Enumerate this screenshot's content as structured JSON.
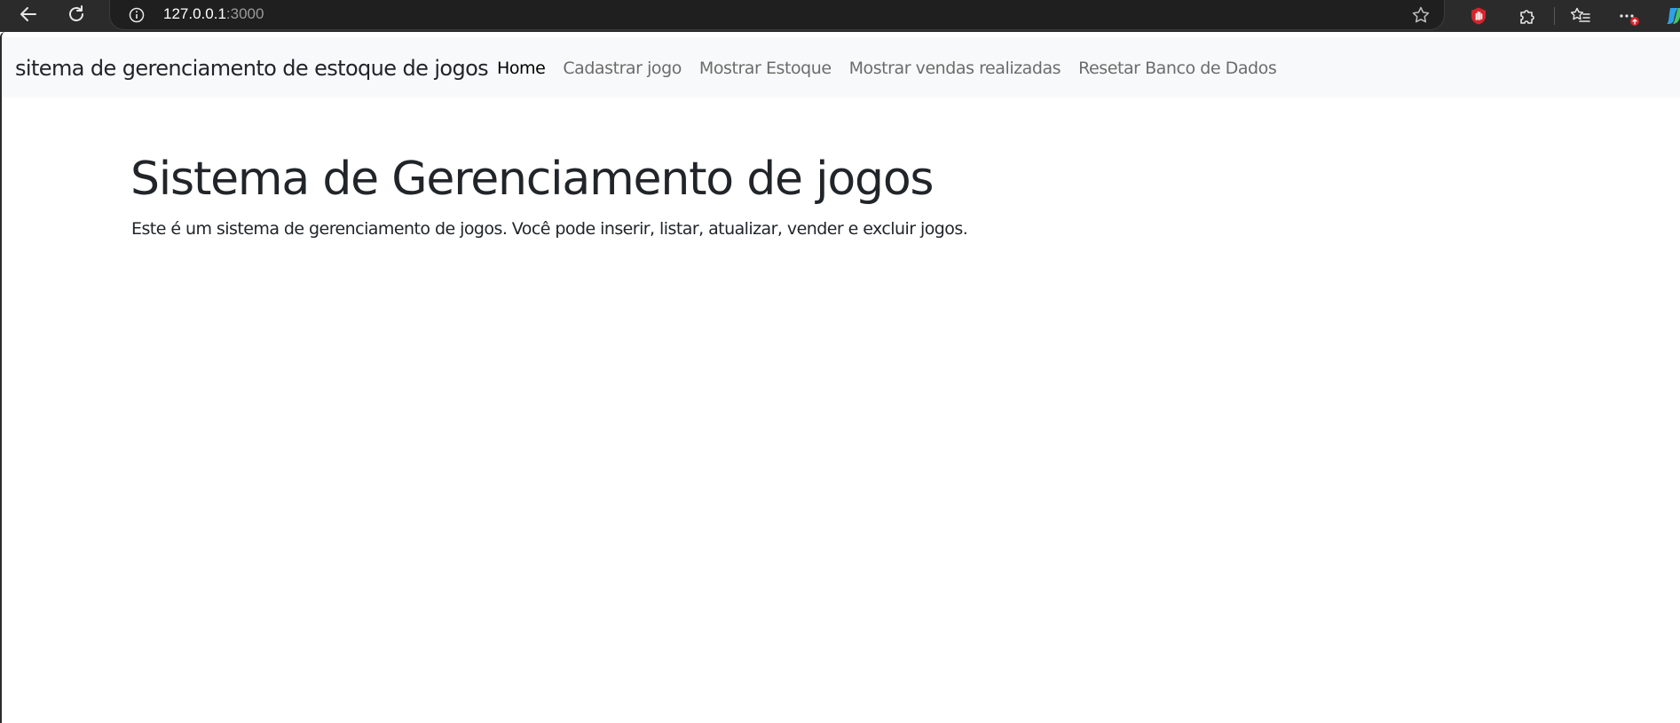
{
  "browser": {
    "url_host": "127.0.0.1",
    "url_port": ":3000",
    "icons": {
      "back": "back-arrow-icon",
      "reload": "reload-icon",
      "info": "info-icon",
      "favorite": "star-icon",
      "extension": "red-hand-extension-icon",
      "extensions": "puzzle-icon",
      "favorites": "favorites-list-icon",
      "more": "more-icon",
      "copilot": "copilot-icon"
    }
  },
  "navbar": {
    "brand": "sitema de gerenciamento de estoque de jogos",
    "links": [
      {
        "label": "Home",
        "active": true
      },
      {
        "label": "Cadastrar jogo",
        "active": false
      },
      {
        "label": "Mostrar Estoque",
        "active": false
      },
      {
        "label": "Mostrar vendas realizadas",
        "active": false
      },
      {
        "label": "Resetar Banco de Dados",
        "active": false
      }
    ]
  },
  "main": {
    "title": "Sistema de Gerenciamento de jogos",
    "description": "Este é um sistema de gerenciamento de jogos. Você pode inserir, listar, atualizar, vender e excluir jogos."
  },
  "colors": {
    "chrome_bg": "#2b2b2b",
    "navbar_bg": "#f8f9fa",
    "text": "#212529",
    "link_muted": "#6c6c6c"
  }
}
